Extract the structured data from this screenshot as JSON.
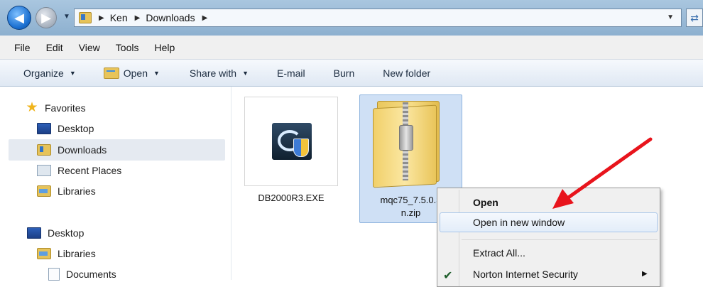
{
  "address_bar": {
    "breadcrumbs": [
      "Ken",
      "Downloads"
    ]
  },
  "menu_bar": {
    "items": [
      "File",
      "Edit",
      "View",
      "Tools",
      "Help"
    ]
  },
  "command_bar": {
    "organize": "Organize",
    "open": "Open",
    "share_with": "Share with",
    "email": "E-mail",
    "burn": "Burn",
    "new_folder": "New folder"
  },
  "nav_pane": {
    "favorites": "Favorites",
    "desktop": "Desktop",
    "downloads": "Downloads",
    "recent_places": "Recent Places",
    "libraries": "Libraries",
    "desktop2": "Desktop",
    "libraries2": "Libraries",
    "documents": "Documents"
  },
  "files": [
    {
      "name": "DB2000R3.EXE"
    },
    {
      "name_line1": "mqc75_7.5.0.3",
      "name_line2": "n.zip"
    }
  ],
  "context_menu": {
    "open": "Open",
    "open_new_window": "Open in new window",
    "extract_all": "Extract All...",
    "norton": "Norton Internet Security"
  },
  "colors": {
    "annotation_arrow": "#e8141c",
    "selection": "#cfe0f5"
  }
}
